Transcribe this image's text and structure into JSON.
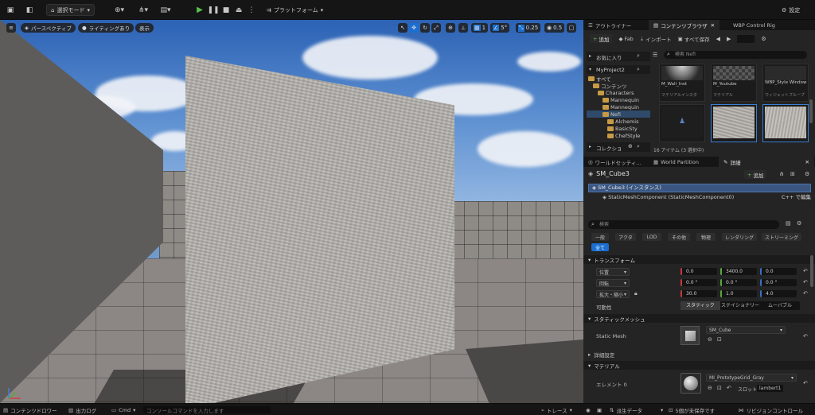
{
  "toolbar": {
    "mode_label": "選択モード",
    "platform_label": "プラットフォーム",
    "settings_label": "設定"
  },
  "viewport": {
    "perspective_label": "パースペクティブ",
    "lighting_label": "ライティングあり",
    "show_label": "表示",
    "grid_snap_value": "1",
    "rotation_snap_value": "5°",
    "scale_snap_value": "0.25",
    "camera_speed_value": "0.5"
  },
  "outliner": {
    "tabs": [
      "アウトライナー",
      "コンテンツブラウザ",
      "WBP Control Rig"
    ],
    "add_label": "追加",
    "fab_label": "Fab",
    "import_label": "インポート",
    "save_all_label": "すべて保存",
    "favorites_label": "お気に入り",
    "project_label": "MyProject2",
    "search_placeholder": "検索 Nefi",
    "tree": [
      "すべて",
      "コンテンツ",
      "Characters",
      "Mannequin",
      "Mannequin",
      "Nefi",
      "Alchemis",
      "BasicSty",
      "ChefStyle"
    ],
    "collections_label": "コレクショ",
    "assets": [
      {
        "name": "M_Wall_Inst",
        "type": "マテリアルインスタ"
      },
      {
        "name": "M_Youtube",
        "type": "マテリアル"
      },
      {
        "name": "WBP_Style Window",
        "type": "ウィジェットブループ"
      }
    ],
    "item_count": "16 アイテム (3 選択中)"
  },
  "details": {
    "tabs": [
      "ワールドセッティ...",
      "World Partition",
      "詳細"
    ],
    "object_name": "SM_Cube3",
    "add_label": "追加",
    "instance_label": "SM_Cube3 (インスタンス)",
    "component_label": "StaticMeshComponent (StaticMeshComponent0)",
    "cpp_edit_label": "C++ で編集",
    "search_placeholder": "検索",
    "categories": [
      "一般",
      "アクタ",
      "LOD",
      "その他",
      "物理",
      "レンダリング",
      "ストリーミング"
    ],
    "all_label": "全て",
    "transform_section": "トランスフォーム",
    "location_label": "位置",
    "location": [
      "0.0",
      "3400.0",
      "0.0"
    ],
    "rotation_label": "回転",
    "rotation": [
      "0.0 °",
      "0.0 °",
      "0.0 °"
    ],
    "scale_label": "拡大・縮小",
    "scale": [
      "30.0",
      "1.0",
      "4.0"
    ],
    "mobility_label": "可動性",
    "mobility_options": [
      "スタティック",
      "ステイショナリー",
      "ムーバブル"
    ],
    "static_mesh_section": "スタティックメッシュ",
    "static_mesh_label": "Static Mesh",
    "static_mesh_value": "SM_Cube",
    "advanced_label": "詳細設定",
    "material_section": "マテリアル",
    "element_label": "エレメント 0",
    "material_value": "MI_PrototypeGrid_Gray",
    "slot_label": "スロット",
    "slot_value": "lambert1"
  },
  "statusbar": {
    "content_drawer": "コンテンツドロワー",
    "output_log": "出力ログ",
    "cmd_label": "Cmd",
    "console_placeholder": "コンソールコマンドを入力します",
    "trace_label": "トレース",
    "derived_data_label": "派生データ",
    "unsaved_label": "5個が未保存です",
    "revision_label": "リビジョンコントロール"
  },
  "colors": {
    "accent": "#1a6fd0",
    "play": "#55c24a",
    "folder": "#c99a45"
  }
}
